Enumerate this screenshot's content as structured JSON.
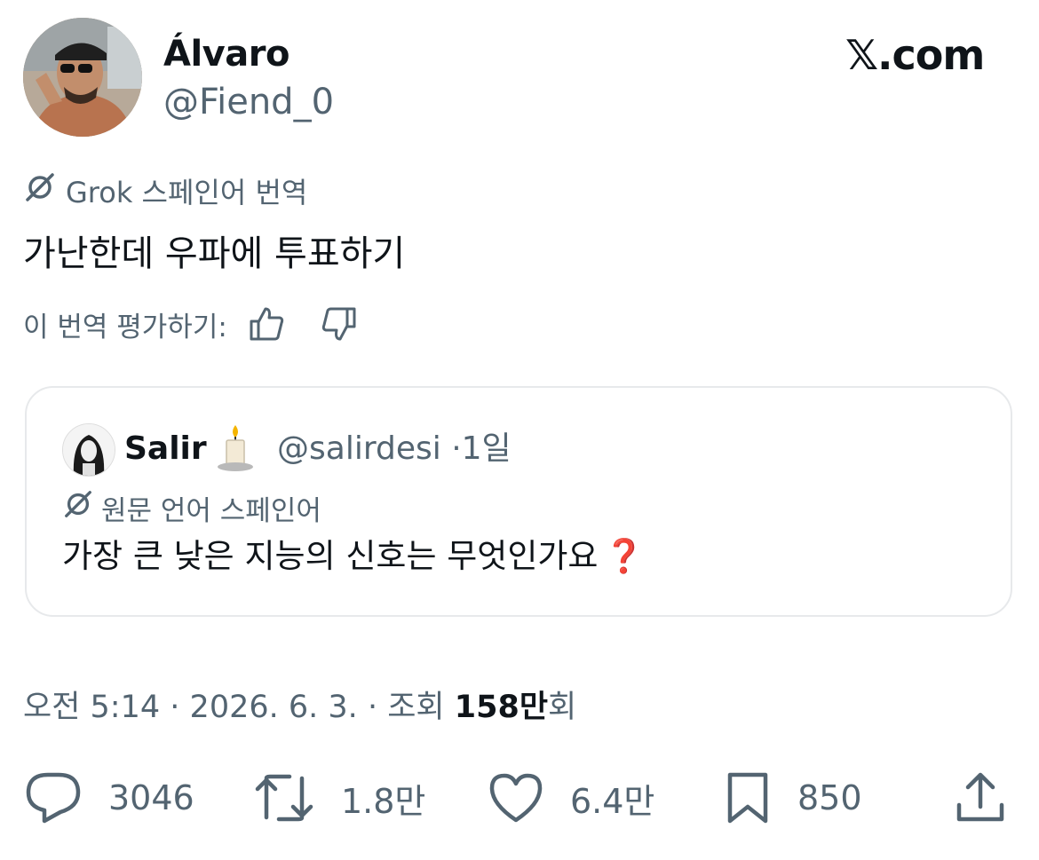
{
  "author": {
    "display_name": "Álvaro",
    "handle": "@Fiend_0"
  },
  "site_logo": "𝕏.com",
  "translation": {
    "label": "Grok 스페인어 번역",
    "text": "가난한데 우파에 투표하기",
    "rate_label": "이 번역 평가하기:"
  },
  "quoted_tweet": {
    "display_name": "Salir",
    "handle": "@salirdesi",
    "separator": "·",
    "time": "1일",
    "language_note": "원문 언어 스페인어",
    "text": "가장 큰 낮은 지능의 신호는 무엇인가요",
    "emoji": "❓"
  },
  "meta": {
    "time": "오전 5:14",
    "date": "2026. 6. 3.",
    "views_label": "조회",
    "views_count": "158만",
    "views_suffix": "회"
  },
  "actions": {
    "replies": "3046",
    "reposts": "1.8만",
    "likes": "6.4만",
    "bookmarks": "850"
  },
  "colors": {
    "text": "#0f1419",
    "secondary": "#536471",
    "border": "#e7e9eb"
  }
}
